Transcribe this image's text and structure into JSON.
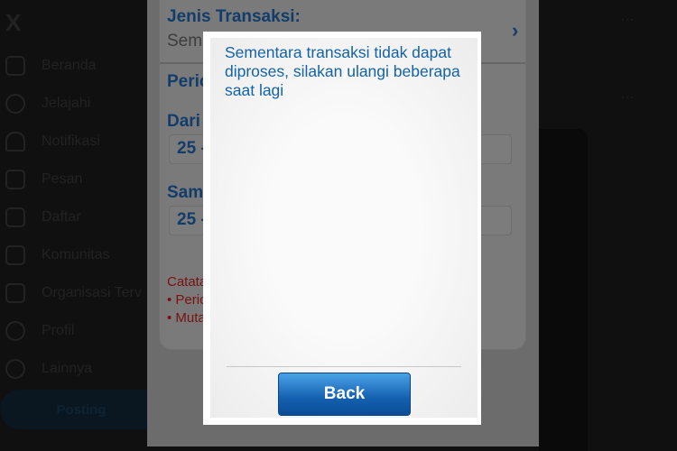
{
  "sidebar": {
    "logo": "X",
    "items": [
      {
        "label": "Beranda",
        "icon": "home-icon"
      },
      {
        "label": "Jelajahi",
        "icon": "search-icon"
      },
      {
        "label": "Notifikasi",
        "icon": "bell-icon"
      },
      {
        "label": "Pesan",
        "icon": "mail-icon"
      },
      {
        "label": "Daftar",
        "icon": "list-icon"
      },
      {
        "label": "Komunitas",
        "icon": "community-icon"
      },
      {
        "label": "Organisasi Terv",
        "icon": "lightning-icon"
      },
      {
        "label": "Profil",
        "icon": "person-icon"
      },
      {
        "label": "Lainnya",
        "icon": "more-circle-icon"
      }
    ],
    "post_label": "Posting"
  },
  "form": {
    "jenis_label": "Jenis Transaksi:",
    "jenis_value": "Semu",
    "periode_label": "Peric",
    "dari_label": "Dari T",
    "dari_value": "25 -",
    "sampai_label": "Samp",
    "sampai_value": "25 -",
    "note_title": "Catata",
    "note_1": "• Peric",
    "note_2": "• Muta"
  },
  "dialog": {
    "message": "Sementara transaksi tidak dapat diproses, silakan ulangi beberapa saat lagi",
    "back_label": "Back"
  },
  "right": {
    "more_1": "···",
    "more_2": "···"
  },
  "colors": {
    "dialog_text": "#1463a8",
    "button": "#1460b0",
    "note": "#c01010"
  }
}
